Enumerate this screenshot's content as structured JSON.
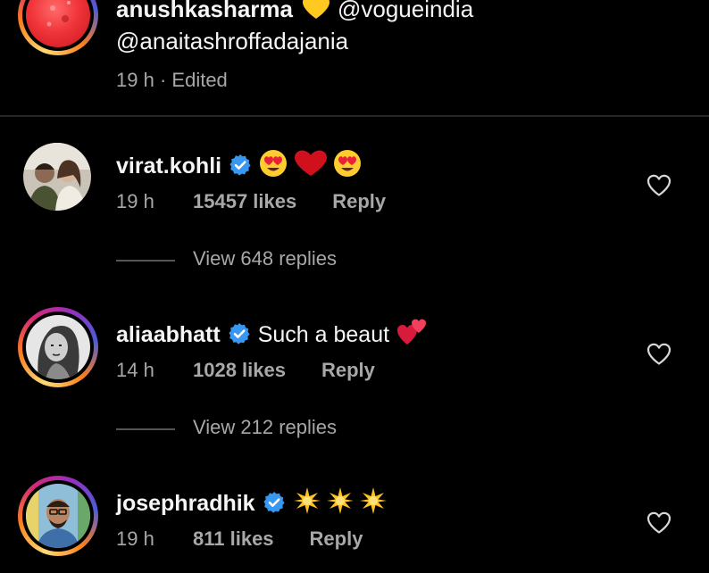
{
  "caption": {
    "username": "anushkasharma",
    "mention1": "@vogueindia",
    "mention2": "@anaitashroffadajania",
    "time": "19 h",
    "separator": "·",
    "edited": "Edited",
    "heart_color": "#ffc91f"
  },
  "comments": [
    {
      "username": "virat.kohli",
      "verified": true,
      "text": "",
      "emojis": [
        "heart-eyes",
        "red-heart",
        "heart-eyes"
      ],
      "time": "19 h",
      "likes": "15457 likes",
      "reply": "Reply",
      "view_replies": "View 648 replies"
    },
    {
      "username": "aliaabhatt",
      "verified": true,
      "text": "Such a beaut",
      "emojis": [
        "two-hearts"
      ],
      "time": "14 h",
      "likes": "1028 likes",
      "reply": "Reply",
      "view_replies": "View 212 replies"
    },
    {
      "username": "josephradhik",
      "verified": true,
      "text": "",
      "emojis": [
        "sparkle",
        "sparkle",
        "sparkle"
      ],
      "time": "19 h",
      "likes": "811 likes",
      "reply": "Reply"
    }
  ],
  "colors": {
    "background": "#000000",
    "verified_blue": "#3897f0",
    "meta_gray": "#a8a8a8"
  }
}
